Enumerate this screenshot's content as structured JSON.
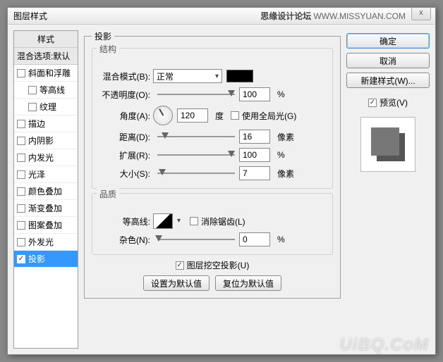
{
  "title": "图层样式",
  "site_label": "思缘设计论坛",
  "site_url": "WWW.MISSYUAN.COM",
  "sidebar": {
    "header": "样式",
    "subheader": "混合选项:默认",
    "items": [
      {
        "label": "斜面和浮雕",
        "checked": false,
        "indent": false
      },
      {
        "label": "等高线",
        "checked": false,
        "indent": true
      },
      {
        "label": "纹理",
        "checked": false,
        "indent": true
      },
      {
        "label": "描边",
        "checked": false,
        "indent": false
      },
      {
        "label": "内阴影",
        "checked": false,
        "indent": false
      },
      {
        "label": "内发光",
        "checked": false,
        "indent": false
      },
      {
        "label": "光泽",
        "checked": false,
        "indent": false
      },
      {
        "label": "颜色叠加",
        "checked": false,
        "indent": false
      },
      {
        "label": "渐变叠加",
        "checked": false,
        "indent": false
      },
      {
        "label": "图案叠加",
        "checked": false,
        "indent": false
      },
      {
        "label": "外发光",
        "checked": false,
        "indent": false
      },
      {
        "label": "投影",
        "checked": true,
        "indent": false,
        "selected": true
      }
    ]
  },
  "panel": {
    "legend": "投影",
    "structure": {
      "title": "结构",
      "blend_mode_label": "混合模式(B):",
      "blend_mode_value": "正常",
      "opacity_label": "不透明度(O):",
      "opacity_value": "100",
      "opacity_unit": "%",
      "angle_label": "角度(A):",
      "angle_value": "120",
      "angle_unit": "度",
      "global_light_label": "使用全局光(G)",
      "global_light_checked": false,
      "distance_label": "距离(D):",
      "distance_value": "16",
      "distance_unit": "像素",
      "spread_label": "扩展(R):",
      "spread_value": "100",
      "spread_unit": "%",
      "size_label": "大小(S):",
      "size_value": "7",
      "size_unit": "像素"
    },
    "quality": {
      "title": "品质",
      "contour_label": "等高线:",
      "antialias_label": "消除锯齿(L)",
      "antialias_checked": false,
      "noise_label": "杂色(N):",
      "noise_value": "0",
      "noise_unit": "%"
    },
    "knockout_label": "图层挖空投影(U)",
    "knockout_checked": true,
    "make_default": "设置为默认值",
    "reset_default": "复位为默认值"
  },
  "right": {
    "ok": "确定",
    "cancel": "取消",
    "new_style": "新建样式(W)...",
    "preview_label": "预览(V)",
    "preview_checked": true
  },
  "watermark": "UiBQ.CoM"
}
